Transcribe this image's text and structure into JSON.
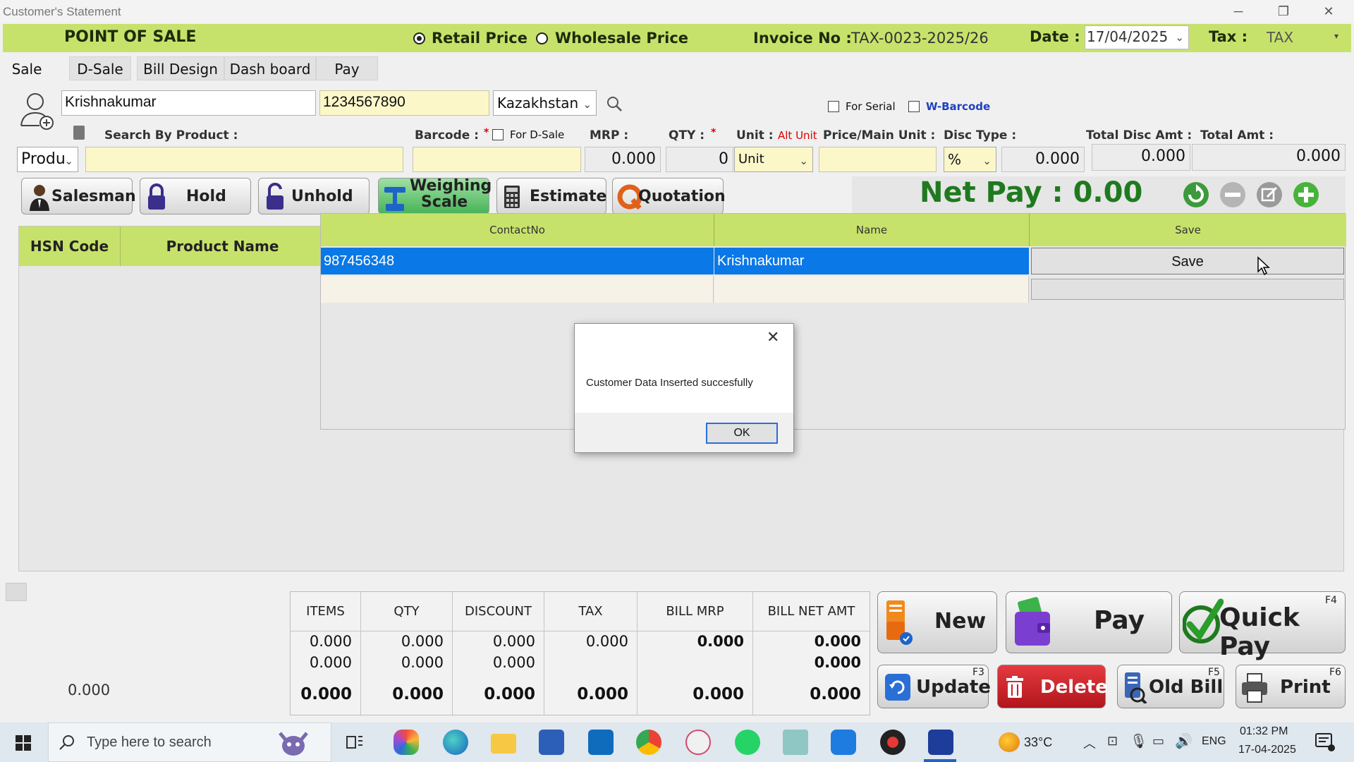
{
  "window": {
    "title": "Customer's Statement",
    "minimize": "─",
    "restore": "❐",
    "close": "✕"
  },
  "header": {
    "app_title": "POINT OF SALE",
    "retail_price_label": "Retail Price",
    "wholesale_price_label": "Wholesale Price",
    "price_mode_selected": "Retail Price",
    "invoice_label": "Invoice No :",
    "invoice_no": "TAX-0023-2025/26",
    "date_label": "Date :",
    "date_value": "17/04/2025",
    "tax_label": "Tax :",
    "tax_value": "TAX"
  },
  "tabs": [
    "Sale",
    "D-Sale",
    "Bill Design",
    "Dash board",
    "Pay"
  ],
  "customer": {
    "name": "Krishnakumar",
    "phone": "1234567890",
    "country": "Kazakhstan",
    "for_serial_label": "For Serial",
    "w_barcode_label": "W-Barcode"
  },
  "entry": {
    "search_label": "Search By Product :",
    "search_mode": "Produ",
    "barcode_label": "Barcode :",
    "barcode_star": "*",
    "for_dsale_label": "For D-Sale",
    "mrp_label": "MRP :",
    "mrp_value": "0.000",
    "qty_label": "QTY :",
    "qty_star": "*",
    "qty_value": "0",
    "unit_label": "Unit :",
    "alt_unit_label": "Alt Unit",
    "unit_value": "Unit",
    "price_label": "Price/Main Unit :",
    "disc_type_label": "Disc Type :",
    "disc_type_value": "%",
    "disc_value": "0.000",
    "total_disc_label": "Total Disc Amt :",
    "total_disc_value": "0.000",
    "total_amt_label": "Total Amt :",
    "total_amt_value": "0.000"
  },
  "actions": {
    "salesman": "Salesman",
    "hold": "Hold",
    "unhold": "Unhold",
    "weighing_1": "Weighing",
    "weighing_2": "Scale",
    "estimate": "Estimate",
    "quotation": "Quotation",
    "net_pay": "Net Pay : 0.00"
  },
  "product_grid": {
    "headers": [
      "HSN Code",
      "Product Name"
    ]
  },
  "customer_grid": {
    "headers": [
      "ContactNo",
      "Name",
      "Save"
    ],
    "rows": [
      {
        "contact": "987456348",
        "name": "Krishnakumar",
        "save": "Save"
      }
    ]
  },
  "dialog": {
    "message": "Customer Data Inserted succesfully",
    "ok": "OK",
    "close": "✕"
  },
  "totals": {
    "left_value": "0.000",
    "headers": [
      "ITEMS",
      "QTY",
      "DISCOUNT",
      "TAX",
      "BILL MRP",
      "BILL NET AMT"
    ],
    "row1": [
      "0.000",
      "0.000",
      "0.000",
      "0.000",
      "0.000",
      "0.000"
    ],
    "row2": [
      "0.000",
      "0.000",
      "0.000",
      "",
      "",
      "0.000"
    ],
    "row3": [
      "0.000",
      "0.000",
      "0.000",
      "0.000",
      "0.000",
      "0.000"
    ]
  },
  "bottom_buttons": {
    "new": "New",
    "pay": "Pay",
    "quick_pay": "Quick Pay",
    "quick_pay_key": "F4",
    "update": "Update",
    "update_key": "F3",
    "delete": "Delete",
    "old_bill": "Old Bill",
    "old_bill_key": "F5",
    "print": "Print",
    "print_key": "F6"
  },
  "taskbar": {
    "search_placeholder": "Type here to search",
    "temperature": "33°C",
    "language": "ENG",
    "time": "01:32 PM",
    "date": "17-04-2025"
  },
  "colors": {
    "header_green": "#c7e26b",
    "selection_blue": "#0a78e6",
    "net_pay_green": "#1f7a1f",
    "delete_red": "#d21f26"
  }
}
